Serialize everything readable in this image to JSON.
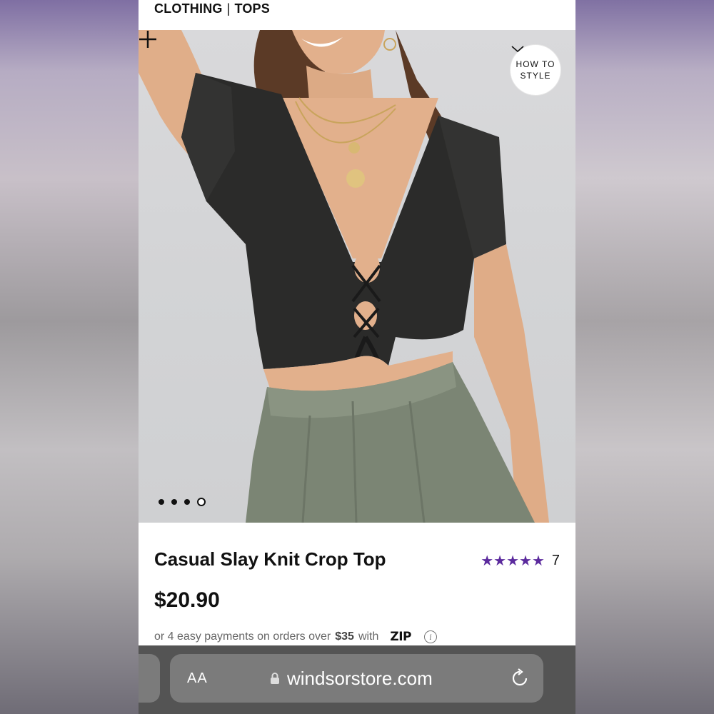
{
  "breadcrumb": {
    "first": "CLOTHING",
    "separator": "|",
    "second": "TOPS"
  },
  "hero": {
    "how_to_line1": "HOW TO",
    "how_to_line2": "STYLE",
    "carousel_total": 4,
    "carousel_active": 4
  },
  "product": {
    "title": "Casual Slay Knit Crop Top",
    "stars": "★★★★★",
    "rating_value": 5,
    "review_count": "7",
    "price": "$20.90",
    "installments_prefix": "or 4 easy payments on orders over",
    "installments_amount": "$35",
    "installments_suffix": "with",
    "zip_logo_text": "ZIP"
  },
  "browser": {
    "aa_label": "AA",
    "url": "windsorstore.com"
  },
  "colors": {
    "accent_purple": "#5b2a9d",
    "browser_bar": "#545454",
    "url_field": "#7b7b7b"
  }
}
